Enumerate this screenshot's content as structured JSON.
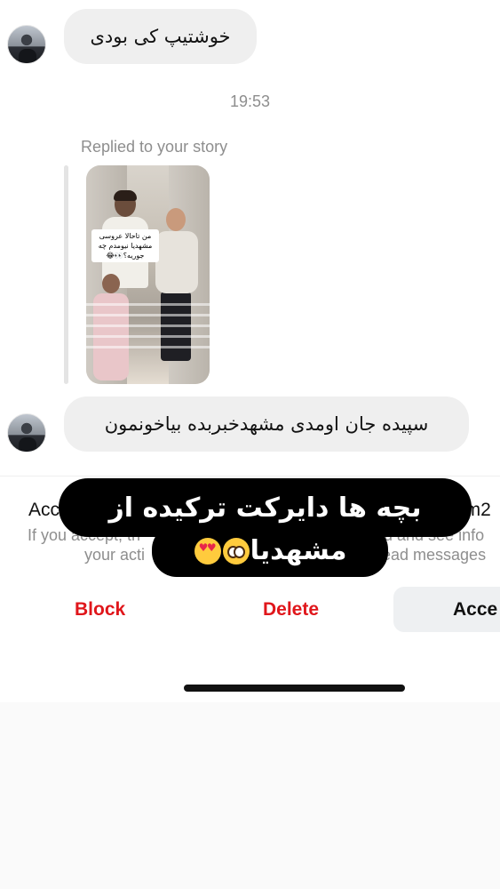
{
  "messages": [
    {
      "text": "خوشتیپ کی بودی"
    },
    {
      "text": "سپیده جان اومدی مشهدخبربده بیاخونمون"
    }
  ],
  "timestamp": "19:53",
  "story_reply": {
    "label": "Replied to your story",
    "caption": "من تاحالا عروسی مشهدیا نیومدم چه جوریه؟👀😂"
  },
  "request": {
    "title_partial": "Acc",
    "username_partial": "_m2",
    "info_line1_left": "If you accept, th",
    "info_line1_right": "u and see info",
    "info_line2_left": "your acti",
    "info_line2_right": "ead messages",
    "block_label": "Block",
    "delete_label": "Delete",
    "accept_label": "Acce"
  },
  "overlay": {
    "line1": "بچه ها دایرکت ترکیده از",
    "line2": "مشهدیا",
    "emojis": [
      "smiling-face-with-heart-eyes",
      "face-holding-back-tears"
    ]
  },
  "colors": {
    "destructive": "#e0161b",
    "bubble": "#efefef",
    "secondary_text": "#8e8e8e"
  }
}
